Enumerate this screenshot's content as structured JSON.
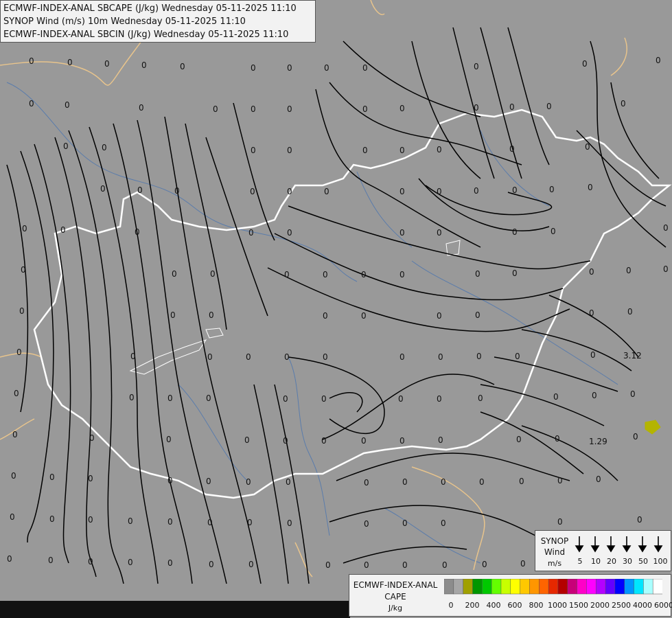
{
  "titles": [
    "ECMWF-INDEX-ANAL SBCAPE (J/kg) Wednesday 05-11-2025 11:10",
    "SYNOP Wind (m/s) 10m Wednesday 05-11-2025 11:10",
    "ECMWF-INDEX-ANAL SBCIN (J/kg) Wednesday 05-11-2025 11:10"
  ],
  "synop_legend": {
    "title": "SYNOP",
    "subtitle": "Wind",
    "unit": "m/s",
    "speeds": [
      "5",
      "10",
      "20",
      "30",
      "50",
      "100"
    ]
  },
  "cape_legend": {
    "title": "ECMWF-INDEX-ANAL",
    "subtitle": "CAPE",
    "unit": "J/kg",
    "ticks": [
      "0",
      "200",
      "400",
      "600",
      "800",
      "1000",
      "1500",
      "2000",
      "2500",
      "4000",
      "6000"
    ],
    "colors": [
      "#8c8c8c",
      "#a6a6a6",
      "#a0a000",
      "#009600",
      "#00c800",
      "#64ff00",
      "#c8ff00",
      "#ffff00",
      "#ffc800",
      "#ff9600",
      "#ff6400",
      "#e62800",
      "#b40000",
      "#c80078",
      "#ff00c8",
      "#ff00ff",
      "#b400ff",
      "#6400ff",
      "#0000ff",
      "#0096ff",
      "#00e6ff",
      "#aaffff",
      "#ffffff"
    ]
  },
  "map": {
    "highlight_values": [
      "3.12",
      "1.29"
    ],
    "colors": {
      "background": "#999999",
      "border": "#ffffff",
      "rivers": "#4a74b0",
      "streamlines": "#000000",
      "foreign_borders": "#e8c48c"
    }
  }
}
